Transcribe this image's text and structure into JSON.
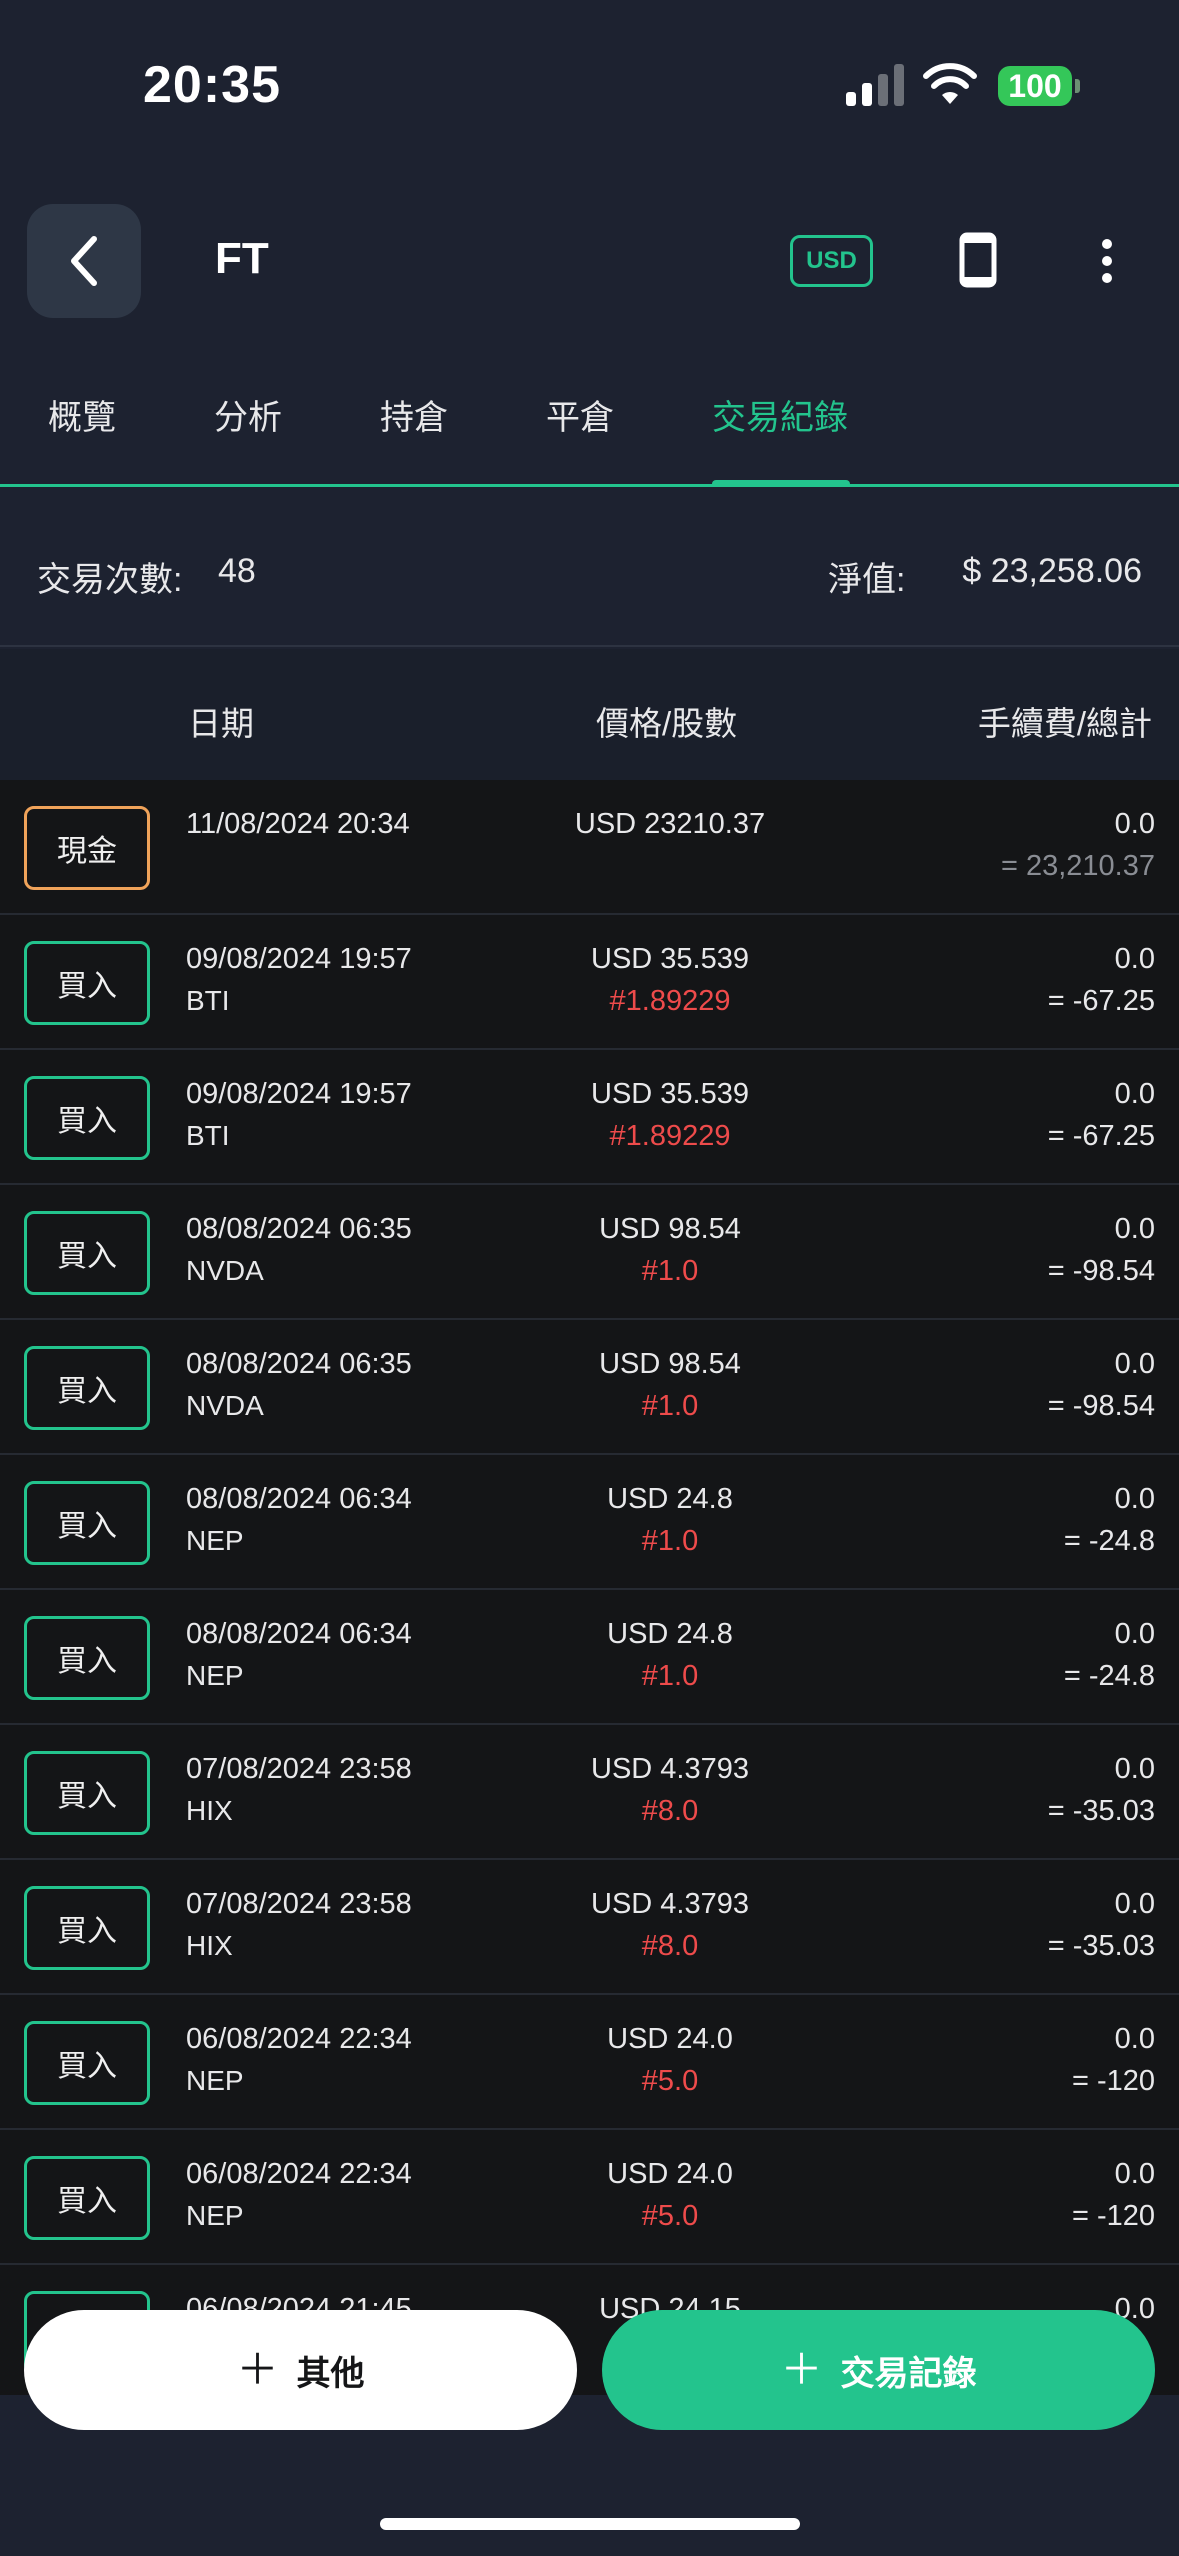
{
  "status_bar": {
    "time": "20:35",
    "battery": "100"
  },
  "header": {
    "title": "FT",
    "currency": "USD"
  },
  "tabs": [
    {
      "label": "概覽"
    },
    {
      "label": "分析"
    },
    {
      "label": "持倉"
    },
    {
      "label": "平倉"
    },
    {
      "label": "交易紀錄",
      "active": true
    }
  ],
  "summary": {
    "count_label": "交易次數:",
    "count_value": "48",
    "nav_label": "淨值:",
    "nav_value": "$ 23,258.06"
  },
  "columns": {
    "date": "日期",
    "price_qty": "價格/股數",
    "fee_total": "手續費/總計"
  },
  "transactions": [
    {
      "type": "現金",
      "date": "11/08/2024 20:34",
      "symbol": "",
      "price": "USD 23210.37",
      "qty": "",
      "fee": "0.0",
      "total": "= 23,210.37"
    },
    {
      "type": "買入",
      "date": "09/08/2024 19:57",
      "symbol": "BTI",
      "price": "USD 35.539",
      "qty": "#1.89229",
      "fee": "0.0",
      "total": "= -67.25"
    },
    {
      "type": "買入",
      "date": "09/08/2024 19:57",
      "symbol": "BTI",
      "price": "USD 35.539",
      "qty": "#1.89229",
      "fee": "0.0",
      "total": "= -67.25"
    },
    {
      "type": "買入",
      "date": "08/08/2024 06:35",
      "symbol": "NVDA",
      "price": "USD 98.54",
      "qty": "#1.0",
      "fee": "0.0",
      "total": "= -98.54"
    },
    {
      "type": "買入",
      "date": "08/08/2024 06:35",
      "symbol": "NVDA",
      "price": "USD 98.54",
      "qty": "#1.0",
      "fee": "0.0",
      "total": "= -98.54"
    },
    {
      "type": "買入",
      "date": "08/08/2024 06:34",
      "symbol": "NEP",
      "price": "USD 24.8",
      "qty": "#1.0",
      "fee": "0.0",
      "total": "= -24.8"
    },
    {
      "type": "買入",
      "date": "08/08/2024 06:34",
      "symbol": "NEP",
      "price": "USD 24.8",
      "qty": "#1.0",
      "fee": "0.0",
      "total": "= -24.8"
    },
    {
      "type": "買入",
      "date": "07/08/2024 23:58",
      "symbol": "HIX",
      "price": "USD 4.3793",
      "qty": "#8.0",
      "fee": "0.0",
      "total": "= -35.03"
    },
    {
      "type": "買入",
      "date": "07/08/2024 23:58",
      "symbol": "HIX",
      "price": "USD 4.3793",
      "qty": "#8.0",
      "fee": "0.0",
      "total": "= -35.03"
    },
    {
      "type": "買入",
      "date": "06/08/2024 22:34",
      "symbol": "NEP",
      "price": "USD 24.0",
      "qty": "#5.0",
      "fee": "0.0",
      "total": "= -120"
    },
    {
      "type": "買入",
      "date": "06/08/2024 22:34",
      "symbol": "NEP",
      "price": "USD 24.0",
      "qty": "#5.0",
      "fee": "0.0",
      "total": "= -120"
    },
    {
      "type": "買入",
      "date": "06/08/2024 21:45",
      "symbol": "",
      "price": "USD 24.15",
      "qty": "",
      "fee": "0.0",
      "total": ""
    }
  ],
  "buttons": {
    "other": "其他",
    "add": "交易記錄"
  },
  "colors": {
    "accent": "#23c48d",
    "cash_badge": "#f0a35a",
    "qty_red": "#ee4b4b",
    "background": "#1d2230",
    "list_bg": "#141517"
  }
}
